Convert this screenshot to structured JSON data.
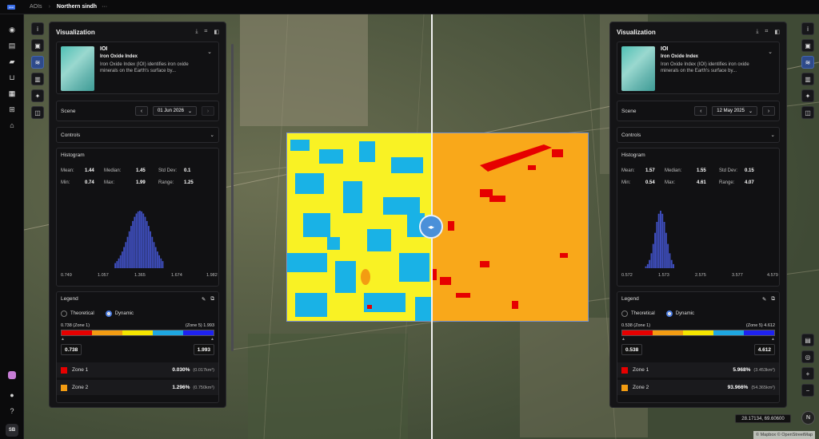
{
  "breadcrumb": {
    "root": "AOIs",
    "current": "Northern sindh",
    "more": "···"
  },
  "brand": {
    "logo_text": "pixel"
  },
  "rail": {
    "avatar": "SB"
  },
  "panels": [
    {
      "title": "Visualization",
      "layer": {
        "name": "IOI",
        "subtitle": "Iron Oxide Index",
        "description": "Iron Oxide Index (IOI) identifies iron oxide minerals on the Earth's surface by..."
      },
      "scene": {
        "label": "Scene",
        "date": "01 Jun 2026"
      },
      "controls": {
        "label": "Controls"
      },
      "histogram": {
        "label": "Histogram",
        "stats": {
          "mean_label": "Mean:",
          "mean": "1.44",
          "median_label": "Median:",
          "median": "1.45",
          "std_label": "Std Dev:",
          "std": "0.1",
          "min_label": "Min:",
          "min": "0.74",
          "max_label": "Max:",
          "max": "1.99",
          "range_label": "Range:",
          "range": "1.25"
        },
        "ticks": [
          "0.749",
          "1.057",
          "1.365",
          "1.674",
          "1.982"
        ]
      },
      "legend": {
        "label": "Legend",
        "theoretical": "Theoretical",
        "dynamic": "Dynamic",
        "range_low": "0.738 (Zone 1)",
        "range_high": "(Zone 5) 1.993",
        "min_value": "0.738",
        "max_value": "1.993",
        "zones": [
          {
            "name": "Zone 1",
            "percent": "0.030%",
            "area": "(0.017km²)",
            "color": "#e60000"
          },
          {
            "name": "Zone 2",
            "percent": "1.296%",
            "area": "(0.750km²)",
            "color": "#f39c12"
          }
        ]
      }
    },
    {
      "title": "Visualization",
      "layer": {
        "name": "IOI",
        "subtitle": "Iron Oxide Index",
        "description": "Iron Oxide Index (IOI) identifies iron oxide minerals on the Earth's surface by..."
      },
      "scene": {
        "label": "Scene",
        "date": "12 May 2025"
      },
      "controls": {
        "label": "Controls"
      },
      "histogram": {
        "label": "Histogram",
        "stats": {
          "mean_label": "Mean:",
          "mean": "1.57",
          "median_label": "Median:",
          "median": "1.55",
          "std_label": "Std Dev:",
          "std": "0.15",
          "min_label": "Min:",
          "min": "0.54",
          "max_label": "Max:",
          "max": "4.61",
          "range_label": "Range:",
          "range": "4.07"
        },
        "ticks": [
          "0.572",
          "1.573",
          "2.575",
          "3.577",
          "4.579"
        ]
      },
      "legend": {
        "label": "Legend",
        "theoretical": "Theoretical",
        "dynamic": "Dynamic",
        "range_low": "0.538 (Zone 1)",
        "range_high": "(Zone 5) 4.612",
        "min_value": "0.538",
        "max_value": "4.612",
        "zones": [
          {
            "name": "Zone 1",
            "percent": "5.968%",
            "area": "(3.453km²)",
            "color": "#e60000"
          },
          {
            "name": "Zone 2",
            "percent": "93.966%",
            "area": "(54.365km²)",
            "color": "#f39c12"
          }
        ]
      }
    }
  ],
  "legend_colors": [
    "#e60000",
    "#f39c12",
    "#f5e600",
    "#1ea7e1",
    "#1e22f0"
  ],
  "map": {
    "coordinates": "28.17134, 69.60600",
    "attribution": "© Mapbox © OpenStreetMap",
    "north": "N"
  }
}
